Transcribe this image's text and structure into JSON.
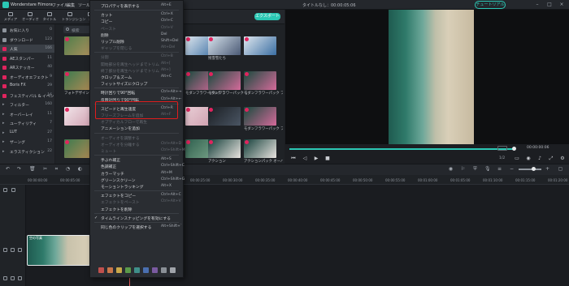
{
  "window": {
    "app_name": "Wonderstare Filmora",
    "menus": [
      "ファイル",
      "編集",
      "ツール"
    ],
    "project_title": "タイトルなし：00:00:05:06",
    "tutorial_label": "チュートリアル",
    "controls": [
      "–",
      "□",
      "×"
    ]
  },
  "toolbar": {
    "tabs": [
      "メディア",
      "オーディオ",
      "タイトル",
      "トランジション",
      "エ"
    ],
    "export_label": "エクスポート"
  },
  "sidebar": {
    "items": [
      {
        "label": "お気に入り",
        "count": "0",
        "icon_color": "#8e949c",
        "active": false
      },
      {
        "label": "ダウンロード",
        "count": "123",
        "icon_color": "#8e949c",
        "active": false
      },
      {
        "label": "人気",
        "count": "166",
        "icon_color": "#e0245e",
        "active": true
      },
      {
        "label": "AEスタンパー",
        "count": "11",
        "icon_color": "#e0245e",
        "active": false
      },
      {
        "label": "ARスナッカー",
        "count": "40",
        "icon_color": "#e0245e",
        "active": false
      },
      {
        "label": "オーディオエフェクト",
        "count": "9",
        "icon_color": "#e0245e",
        "active": false
      },
      {
        "label": "Boris FX",
        "count": "29",
        "icon_color": "#e0245e",
        "active": false
      },
      {
        "label": "フェスティバル & イベント",
        "count": "16",
        "icon_color": "#e0245e",
        "active": false
      },
      {
        "label": "フィルター",
        "count": "160",
        "icon_color": "",
        "active": false
      },
      {
        "label": "オーバーレイ",
        "count": "11",
        "icon_color": "",
        "active": false
      },
      {
        "label": "ユーティリティ",
        "count": "7",
        "icon_color": "",
        "active": false
      },
      {
        "label": "LUT",
        "count": "27",
        "icon_color": "",
        "active": false
      },
      {
        "label": "ザーング",
        "count": "17",
        "icon_color": "",
        "active": false
      },
      {
        "label": "エラスティクション",
        "count": "22",
        "icon_color": "",
        "active": false
      }
    ]
  },
  "media": {
    "search_placeholder": "検索",
    "thumbs": [
      {
        "label": "",
        "colors": [
          "#4f7d4a",
          "#b7935f"
        ]
      },
      {
        "label": "",
        "colors": [
          "#dfe7ee",
          "#3b6fa3"
        ]
      },
      {
        "label": "",
        "colors": [
          "#dfe7ee",
          "#b34a3a"
        ]
      },
      {
        "label": "",
        "colors": [
          "#dfe7ee",
          "#3b6fa3"
        ]
      },
      {
        "label": "残雪雪たち",
        "colors": [
          "#d6e2ec",
          "#4b5a75"
        ]
      },
      {
        "label": "フォトデザインパック1",
        "colors": [
          "#3d7a4f",
          "#b98b54"
        ]
      },
      {
        "label": "モダンフラワーパック フ…",
        "colors": [
          "#184a3d",
          "#d46a9a"
        ]
      },
      {
        "label": "モダンフラワーパック フ…",
        "colors": [
          "#184a3d",
          "#d46a9a"
        ]
      },
      {
        "label": "モダンフラワーパック フ…",
        "colors": [
          "#184a3d",
          "#d46a9a"
        ]
      },
      {
        "label": "",
        "colors": [
          "#f2e6ea",
          "#c9a"
        ]
      },
      {
        "label": "",
        "colors": [
          "#e9cfd6",
          "#c9a"
        ]
      },
      {
        "label": "",
        "colors": [
          "#1b1f24",
          "#4a5563"
        ]
      },
      {
        "label": "",
        "colors": [
          "#3d7a4f",
          "#b98b54"
        ]
      },
      {
        "label": "",
        "colors": [
          "#2f5f4e",
          "#7ba68b"
        ]
      },
      {
        "label": "",
        "colors": [
          "#3d4a55",
          "#8aa0b0"
        ]
      },
      {
        "label": "アクション",
        "colors": [
          "#143f3a",
          "#e8e3df"
        ]
      },
      {
        "label": "アクションパック オーバーレイ",
        "colors": [
          "#143f3a",
          "#e8e3df"
        ]
      },
      {
        "label": "モダンフラワーパック フ…",
        "colors": [
          "#184a3d",
          "#d46a9a"
        ]
      }
    ]
  },
  "context_menu": {
    "items": [
      {
        "type": "item",
        "label": "プロパティを表示する",
        "shortcut": "Alt+E",
        "disabled": false,
        "checked": false
      },
      {
        "type": "sep"
      },
      {
        "type": "item",
        "label": "カット",
        "shortcut": "Ctrl+X",
        "disabled": false,
        "checked": false
      },
      {
        "type": "item",
        "label": "コピー",
        "shortcut": "Ctrl+C",
        "disabled": false,
        "checked": false
      },
      {
        "type": "item",
        "label": "ペースト",
        "shortcut": "Ctrl+V",
        "disabled": true,
        "checked": false
      },
      {
        "type": "item",
        "label": "削除",
        "shortcut": "Del",
        "disabled": false,
        "checked": false
      },
      {
        "type": "item",
        "label": "リップル削除",
        "shortcut": "Shift+Del",
        "disabled": false,
        "checked": false
      },
      {
        "type": "item",
        "label": "ギャップを閉じる",
        "shortcut": "Alt+Del",
        "disabled": true,
        "checked": false
      },
      {
        "type": "sep"
      },
      {
        "type": "item",
        "label": "分割",
        "shortcut": "Ctrl+B",
        "disabled": true,
        "checked": false
      },
      {
        "type": "item",
        "label": "開始部分を再生ヘッドまでトリム",
        "shortcut": "Alt+[",
        "disabled": true,
        "checked": false
      },
      {
        "type": "item",
        "label": "終了部分を再生ヘッドまでトリム",
        "shortcut": "Alt+]",
        "disabled": true,
        "checked": false
      },
      {
        "type": "item",
        "label": "クロップ＆ズーム",
        "shortcut": "Alt+C",
        "disabled": false,
        "checked": false
      },
      {
        "type": "item",
        "label": "フィットサイズにクロップ",
        "shortcut": "",
        "disabled": false,
        "checked": false
      },
      {
        "type": "sep"
      },
      {
        "type": "item",
        "label": "時計回りで90°回転",
        "shortcut": "Ctrl+Alt+→",
        "disabled": false,
        "checked": false
      },
      {
        "type": "item",
        "label": "反時計回りで90°回転",
        "shortcut": "Ctrl+Alt+←",
        "disabled": false,
        "checked": false
      },
      {
        "type": "sep"
      },
      {
        "type": "item",
        "label": "スピードと再生速度",
        "shortcut": "Ctrl+R",
        "disabled": false,
        "checked": false
      },
      {
        "type": "item",
        "label": "フリーズフレームを追加",
        "shortcut": "Alt+F",
        "disabled": true,
        "checked": false
      },
      {
        "type": "item",
        "label": "オプティカルフローで再生",
        "shortcut": "",
        "disabled": true,
        "checked": false
      },
      {
        "type": "item",
        "label": "アニメーションを追加",
        "shortcut": "",
        "disabled": false,
        "checked": false
      },
      {
        "type": "sep"
      },
      {
        "type": "item",
        "label": "オーディオを調整する",
        "shortcut": "",
        "disabled": true,
        "checked": false
      },
      {
        "type": "item",
        "label": "オーディオを分離する",
        "shortcut": "Ctrl+Alt+D",
        "disabled": true,
        "checked": false
      },
      {
        "type": "item",
        "label": "ミュート",
        "shortcut": "Ctrl+Shift+M",
        "disabled": true,
        "checked": false
      },
      {
        "type": "sep"
      },
      {
        "type": "item",
        "label": "手ぶれ補正",
        "shortcut": "Alt+S",
        "disabled": false,
        "checked": false
      },
      {
        "type": "item",
        "label": "色調補正",
        "shortcut": "Ctrl+Shift+C",
        "disabled": false,
        "checked": false
      },
      {
        "type": "item",
        "label": "カラーマッチ",
        "shortcut": "Alt+M",
        "disabled": false,
        "checked": false
      },
      {
        "type": "item",
        "label": "グリーンスクリーン",
        "shortcut": "Ctrl+Shift+G",
        "disabled": false,
        "checked": false
      },
      {
        "type": "item",
        "label": "モーショントラッキング",
        "shortcut": "Alt+X",
        "disabled": false,
        "checked": false
      },
      {
        "type": "sep"
      },
      {
        "type": "item",
        "label": "エフェクトをコピー",
        "shortcut": "Ctrl+Alt+C",
        "disabled": false,
        "checked": false
      },
      {
        "type": "item",
        "label": "エフェクトをペースト",
        "shortcut": "Ctrl+Alt+V",
        "disabled": true,
        "checked": false
      },
      {
        "type": "item",
        "label": "エフェクトを削除",
        "shortcut": "",
        "disabled": false,
        "checked": false
      },
      {
        "type": "sep"
      },
      {
        "type": "item",
        "label": "タイムラインスナッピングを有効にする",
        "shortcut": "",
        "disabled": false,
        "checked": true
      },
      {
        "type": "sep"
      },
      {
        "type": "item",
        "label": "同じ色のクリップを選択する",
        "shortcut": "Alt+Shift+`",
        "disabled": false,
        "checked": false
      }
    ],
    "swatches": [
      "#c0504d",
      "#c9774a",
      "#c9a84a",
      "#5a9a4a",
      "#3f8f8a",
      "#4a6fb0",
      "#7a5aa0",
      "#8a8f96",
      "#a0a4aa"
    ]
  },
  "preview": {
    "timecode": "00:00:00:06",
    "page_indicator": "1/2",
    "progress_fraction": 1.0
  },
  "timeline": {
    "ruler_labels": [
      "00:00:00:00",
      "00:00:05:00",
      "00:00:10:00",
      "00:00:15:00",
      "00:00:20:00",
      "00:00:25:00",
      "00:00:30:00",
      "00:00:35:00",
      "00:00:40:00",
      "00:00:45:00",
      "00:00:50:00",
      "00:00:55:00",
      "00:01:00:00",
      "00:01:05:00",
      "00:01:10:00",
      "00:01:15:00",
      "00:01:20:00"
    ],
    "clip_name": "空の写真"
  }
}
